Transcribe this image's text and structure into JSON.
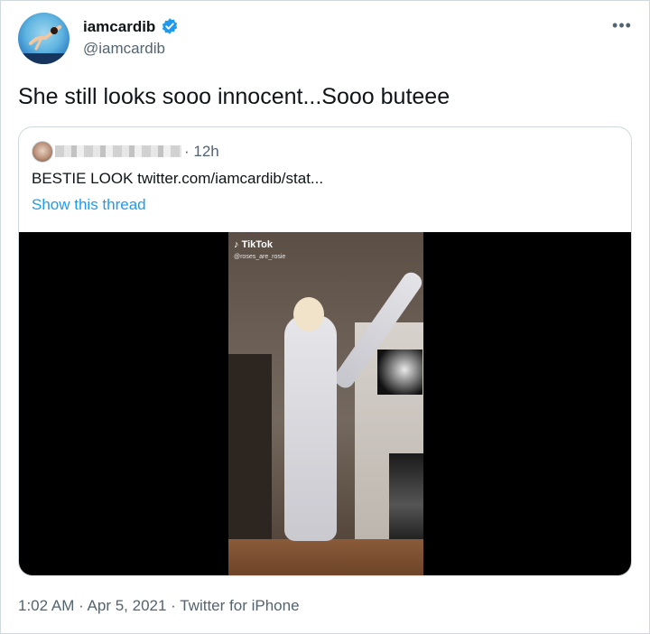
{
  "author": {
    "display_name": "iamcardib",
    "handle": "@iamcardib",
    "verified": true
  },
  "menu_icon": "more-horizontal-icon",
  "tweet": {
    "text": "She still looks sooo innocent...Sooo buteee"
  },
  "quoted_tweet": {
    "time": "· 12h",
    "text": "BESTIE LOOK  twitter.com/iamcardib/stat...",
    "show_thread": "Show this thread",
    "video_overlay": {
      "brand": "TikTok",
      "handle": "@roses_are_rosie"
    }
  },
  "meta": {
    "timestamp": "1:02 AM · Apr 5, 2021 · Twitter for iPhone"
  },
  "colors": {
    "link": "#1d9bf0",
    "muted": "#536471",
    "verified": "#1d9bf0"
  }
}
